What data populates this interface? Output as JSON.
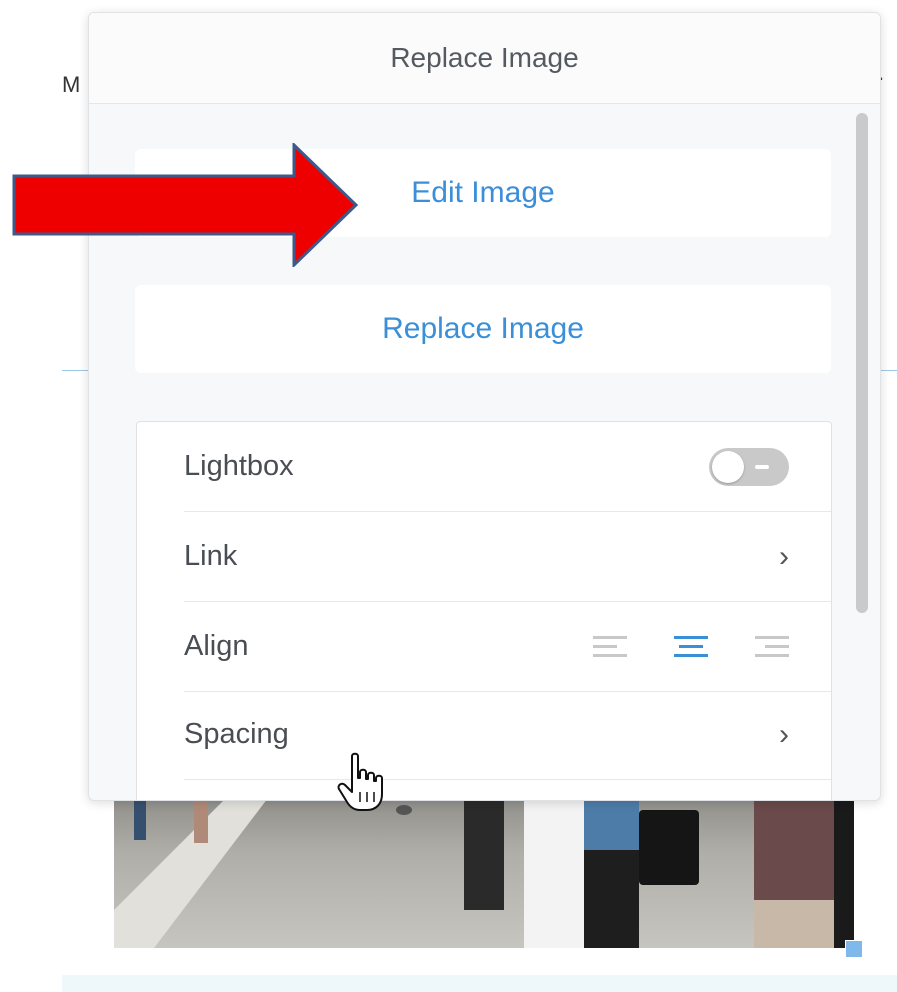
{
  "background": {
    "left_letter": "M",
    "right_mark": "."
  },
  "panel": {
    "title": "Replace Image",
    "edit_button_label": "Edit Image",
    "replace_button_label": "Replace Image",
    "settings": [
      {
        "label": "Lightbox",
        "control": "toggle",
        "toggle_on": false
      },
      {
        "label": "Link",
        "control": "chevron"
      },
      {
        "label": "Align",
        "control": "align-group",
        "options": [
          "align-left-icon",
          "align-center-icon",
          "align-right-icon"
        ],
        "selected": "align-center-icon"
      },
      {
        "label": "Spacing",
        "control": "chevron"
      }
    ],
    "chevron_glyph": "›"
  },
  "annotation": {
    "arrow_color": "#ee0000",
    "arrow_outline": "#3d5a8a"
  },
  "colors": {
    "accent": "#3b8fd8",
    "inactive": "#c9c9c9"
  }
}
